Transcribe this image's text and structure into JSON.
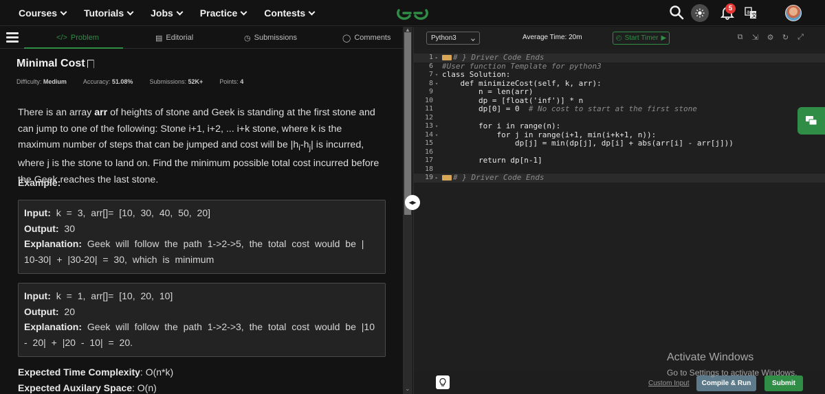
{
  "nav": {
    "items": [
      "Courses",
      "Tutorials",
      "Jobs",
      "Practice",
      "Contests"
    ],
    "notification_count": "5"
  },
  "left_tabs": {
    "problem": "Problem",
    "editorial": "Editorial",
    "submissions": "Submissions",
    "comments": "Comments"
  },
  "problem": {
    "title": "Minimal Cost",
    "difficulty_label": "Difficulty:",
    "difficulty": "Medium",
    "accuracy_label": "Accuracy:",
    "accuracy": "51.08%",
    "submissions_label": "Submissions:",
    "submissions": "52K+",
    "points_label": "Points:",
    "points": "4",
    "desc_1": "There is an array ",
    "desc_arr": "arr",
    "desc_2": " of heights of stone and Geek is standing at the first stone and can jump to one of the following: Stone i+1, i+2, ... i+k stone, where k is the maximum number of steps that can be jumped and cost will be |h",
    "desc_sub_i": "i",
    "desc_3": "-h",
    "desc_sub_j": "j",
    "desc_4": "| is incurred, where j is the stone to land on. Find the minimum possible total cost incurred before the Geek reaches the last stone.",
    "example_heading": "Example:",
    "examples": [
      {
        "input_label": "Input:",
        "input": " k = 3, arr[]= [10, 30, 40, 50, 20]",
        "output_label": "Output:",
        "output": " 30",
        "explanation_label": "Explanation:",
        "explanation": " Geek will follow the path 1->2->5, the total cost would be | 10-30| + |30-20| = 30, which is minimum"
      },
      {
        "input_label": "Input:",
        "input": " k = 1, arr[]= [10, 20, 10]",
        "output_label": "Output:",
        "output": " 20",
        "explanation_label": "Explanation:",
        "explanation": " Geek will follow the path 1->2->3, the total cost would be |10 - 20| + |20 - 10| = 20."
      }
    ],
    "time_label": "Expected Time Complexity",
    "time_value": ": O(n*k)",
    "space_label": "Expected Auxilary Space",
    "space_value": ": O(n)"
  },
  "editor": {
    "language": "Python3",
    "average_time": "Average Time: 20m",
    "start_timer": "Start Timer",
    "lines": [
      {
        "n": "1",
        "fold": "▸",
        "text": "# } Driver Code Ends",
        "type": "collapsed"
      },
      {
        "n": "6",
        "fold": "",
        "text": "#User function Template for python3",
        "type": "comment"
      },
      {
        "n": "7",
        "fold": "▾",
        "text": "class Solution:",
        "type": "code"
      },
      {
        "n": "8",
        "fold": "▾",
        "text": "    def minimizeCost(self, k, arr):",
        "type": "code"
      },
      {
        "n": "9",
        "fold": "",
        "text": "        n = len(arr)",
        "type": "code"
      },
      {
        "n": "10",
        "fold": "",
        "text": "        dp = [float('inf')] * n",
        "type": "code"
      },
      {
        "n": "11",
        "fold": "",
        "text": "        dp[0] = 0  # No cost to start at the first stone",
        "type": "code"
      },
      {
        "n": "12",
        "fold": "",
        "text": "",
        "type": "code"
      },
      {
        "n": "13",
        "fold": "▾",
        "text": "        for i in range(n):",
        "type": "code"
      },
      {
        "n": "14",
        "fold": "▾",
        "text": "            for j in range(i+1, min(i+k+1, n)):",
        "type": "code"
      },
      {
        "n": "15",
        "fold": "",
        "text": "                dp[j] = min(dp[j], dp[i] + abs(arr[i] - arr[j]))",
        "type": "code"
      },
      {
        "n": "16",
        "fold": "",
        "text": "",
        "type": "code"
      },
      {
        "n": "17",
        "fold": "",
        "text": "        return dp[n-1]",
        "type": "code"
      },
      {
        "n": "18",
        "fold": "",
        "text": "",
        "type": "code"
      },
      {
        "n": "19",
        "fold": "▸",
        "text": "# } Driver Code Ends",
        "type": "collapsed"
      }
    ],
    "custom_input": "Custom Input",
    "compile_run": "Compile & Run",
    "submit": "Submit"
  },
  "watermark": {
    "line1": "Activate Windows",
    "line2": "Go to Settings to activate Windows."
  },
  "colors": {
    "accent_green": "#2f8d46",
    "compile_btn": "#5d7a8a",
    "badge_red": "#e53935"
  }
}
